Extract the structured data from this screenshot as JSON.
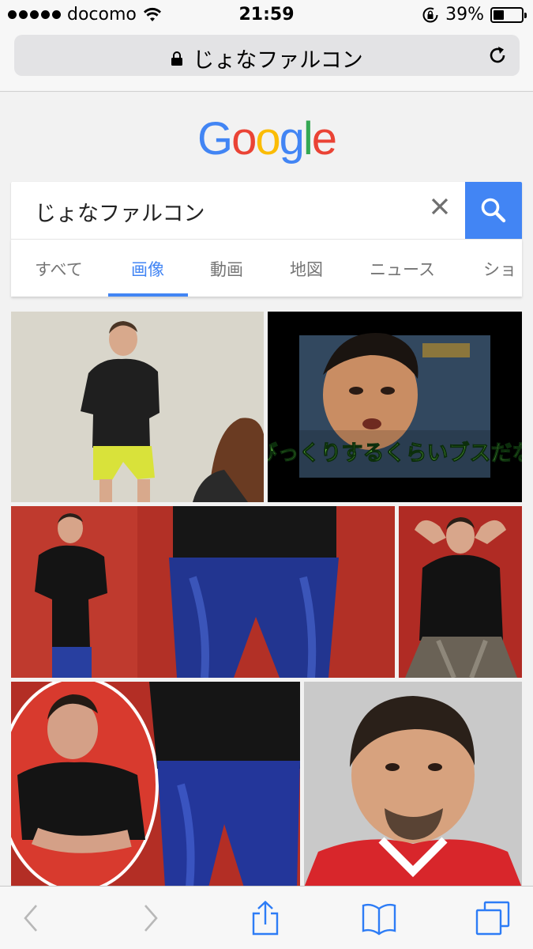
{
  "status_bar": {
    "carrier": "docomo",
    "time": "21:59",
    "battery": "39%",
    "battery_level": 0.39
  },
  "browser": {
    "url_display": "じょなファルコン"
  },
  "google": {
    "logo": "Google",
    "search_query": "じょなファルコン",
    "colors": {
      "blue": "#4285f4",
      "red": "#ea4335",
      "yellow": "#fbbc05",
      "green": "#34a853"
    },
    "tabs": [
      {
        "label": "すべて",
        "active": false
      },
      {
        "label": "画像",
        "active": true
      },
      {
        "label": "動画",
        "active": false
      },
      {
        "label": "地図",
        "active": false
      },
      {
        "label": "ニュース",
        "active": false
      },
      {
        "label": "ショ",
        "active": false
      }
    ],
    "image_overlay_caption": "びっくりするくらいブスだな"
  },
  "toolbar": {
    "icons": [
      "back-icon",
      "forward-icon",
      "share-icon",
      "bookmarks-icon",
      "tabs-icon"
    ]
  }
}
